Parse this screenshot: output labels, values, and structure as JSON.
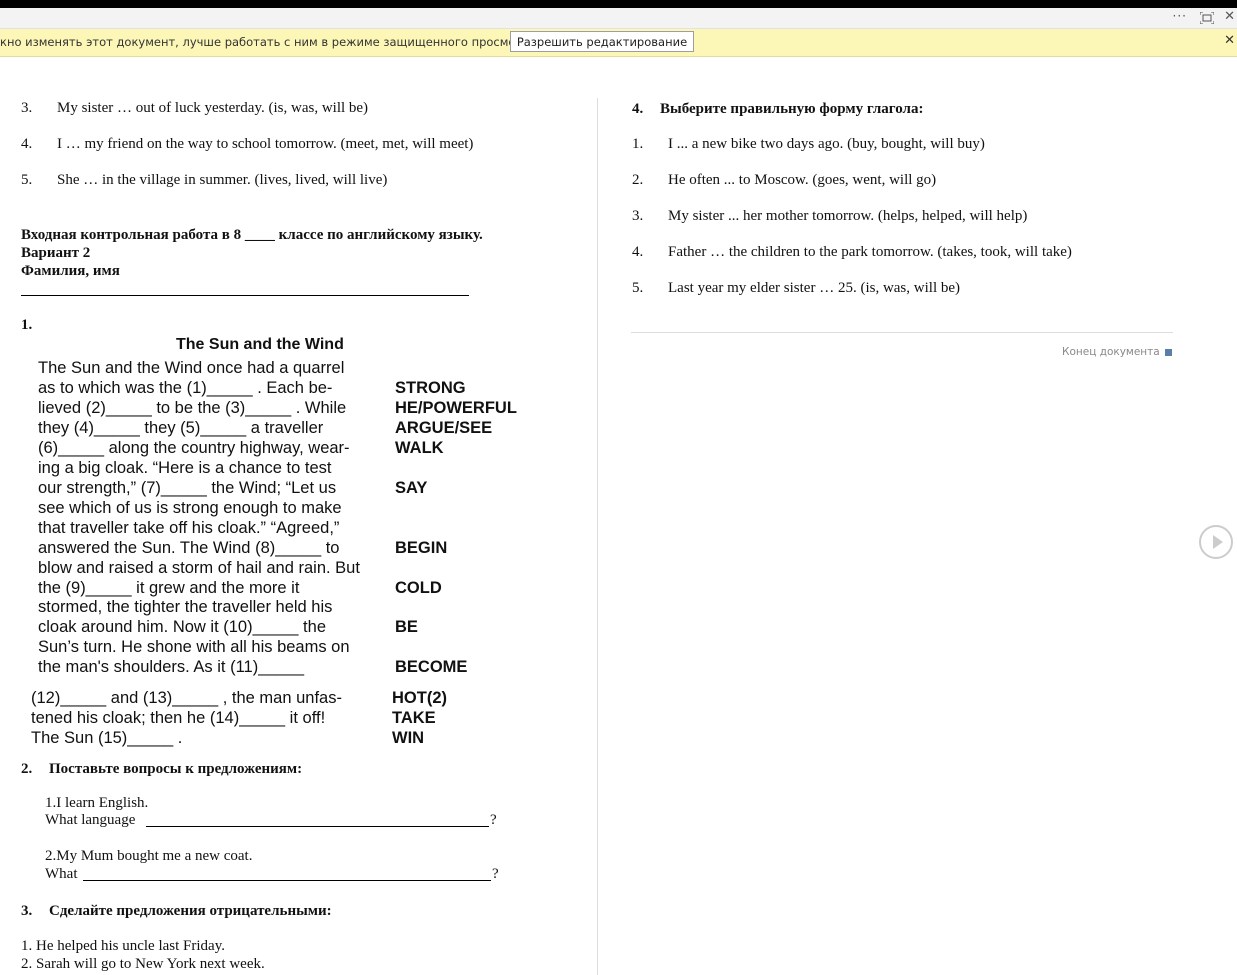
{
  "window": {
    "more_icon": "more-icon",
    "fit_icon": "fit-window-icon",
    "close_icon": "close-icon",
    "dots": "···",
    "close_glyph": "✕"
  },
  "message_bar": {
    "text": "кно изменять этот документ, лучше работать с ним в режиме защищенного просмотра.",
    "button": "Разрешить редактирование",
    "close": "✕"
  },
  "left": {
    "items_top": [
      {
        "num": "3.",
        "text": "My sister … out of luck yesterday. (is, was, will be)"
      },
      {
        "num": "4.",
        "text": "I … my friend on the way to school  tomorrow. (meet, met, will meet)"
      },
      {
        "num": "5.",
        "text": "She … in the village  in summer. (lives, lived, will live)"
      }
    ],
    "heading_line1": "Входная контрольная работа в  8  ____ классе по английскому языку.",
    "heading_line2": "Вариант 2",
    "heading_line3": "Фамилия, имя",
    "section1_num": "1.",
    "story_title": "The Sun and the Wind",
    "story_lines": [
      "The Sun and the Wind once had a quarrel",
      "as to which was the (1)_____ . Each be-",
      "lieved (2)_____ to be the (3)_____ . While",
      "they  (4)_____  they  (5)_____  a  traveller",
      "(6)_____ along the country highway, wear-",
      "ing a big cloak. “Here is a chance to test",
      "our strength,” (7)_____ the Wind; “Let us",
      "see which of us is strong enough to make",
      "that traveller take off his cloak.” “Agreed,”",
      "answered the Sun. The Wind (8)_____ to",
      "blow and raised a storm of hail and rain. But",
      "the  (9)_____  it  grew  and  the  more  it",
      "stormed, the tighter the traveller held his",
      "cloak around him. Now it (10)_____ the",
      "Sun’s turn. He shone with all his beams on",
      "the  man's  shoulders.  As  it  (11)_____",
      "(12)_____ and (13)_____ , the man unfas-",
      "tened his cloak; then he (14)_____ it off!",
      "The Sun (15)_____ ."
    ],
    "story_keywords": [
      {
        "line": 1,
        "word": "STRONG"
      },
      {
        "line": 2,
        "word": "HE/POWERFUL"
      },
      {
        "line": 3,
        "word": "ARGUE/SEE"
      },
      {
        "line": 4,
        "word": "WALK"
      },
      {
        "line": 6,
        "word": "SAY"
      },
      {
        "line": 9,
        "word": "BEGIN"
      },
      {
        "line": 11,
        "word": "COLD"
      },
      {
        "line": 13,
        "word": "BE"
      },
      {
        "line": 15,
        "word": "BECOME"
      },
      {
        "line": 16,
        "word": "HOT(2)"
      },
      {
        "line": 17,
        "word": "TAKE"
      },
      {
        "line": 18,
        "word": "WIN"
      }
    ],
    "section2": {
      "num": "2.",
      "title": "Поставьте вопросы к предложениям:",
      "q1_sentence": "1.I learn English.",
      "q1_prompt": "What language",
      "q2_sentence": "2.My Mum bought me a new coat.",
      "q2_prompt": "What",
      "qmark": "?"
    },
    "section3": {
      "num": "3.",
      "title": "Сделайте предложения отрицательными:",
      "items": [
        "1. He helped his uncle last Friday.",
        "2. Sarah will go to New York next week."
      ]
    }
  },
  "right": {
    "section4": {
      "num": "4.",
      "title": "Выберите правильную форму глагола:",
      "items": [
        {
          "num": "1.",
          "text": "I ... a new bike two days ago. (buy, bought, will buy)"
        },
        {
          "num": "2.",
          "text": "He often ... to Moscow. (goes, went, will go)"
        },
        {
          "num": "3.",
          "text": " My sister ... her mother tomorrow. (helps, helped, will help)"
        },
        {
          "num": "4.",
          "text": "Father … the children to the park tomorrow. (takes, took, will take)"
        },
        {
          "num": "5.",
          "text": "Last year my elder sister … 25. (is, was, will be)"
        }
      ]
    },
    "end_of_document": "Конец документа",
    "play_icon": "play-icon"
  }
}
